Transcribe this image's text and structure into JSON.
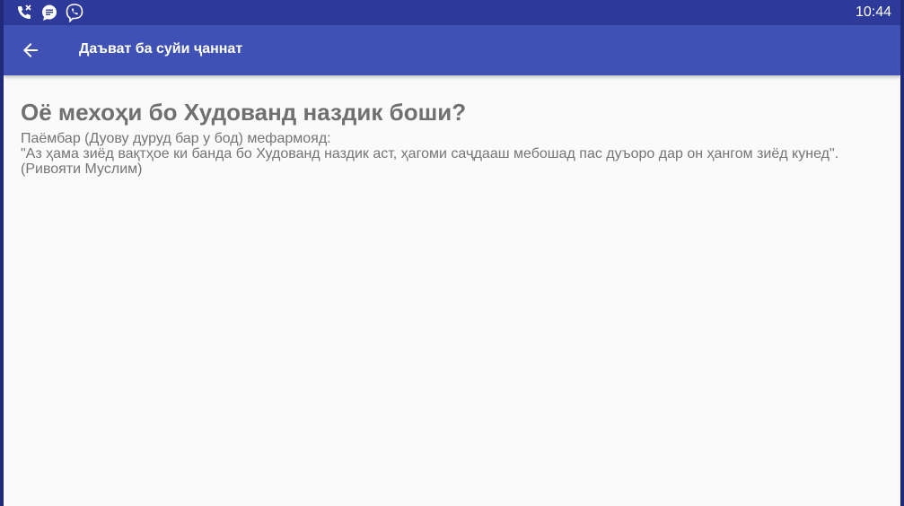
{
  "status_bar": {
    "time": "10:44",
    "icons": [
      "missed-call-icon",
      "message-icon",
      "viber-icon"
    ]
  },
  "app_bar": {
    "title": "Даъват ба суйи ҷаннат",
    "back_icon": "arrow-left-icon"
  },
  "article": {
    "heading": "Оё мехоҳи бо Худованд наздик боши?",
    "intro": "Паёмбар (Дуову дуруд бар у бод) мефармояд:",
    "hadith": "\"Аз ҳама зиёд вақтҳое ки банда бо Худованд наздик аст, ҳагоми саҷдааш мебошад пас дуъоро дар он ҳангом зиёд кунед\".(Ривояти Муслим)"
  },
  "colors": {
    "status_bar": "#2d3a9a",
    "app_bar": "#3f51b5",
    "background": "#fafafa",
    "text": "#757575"
  }
}
